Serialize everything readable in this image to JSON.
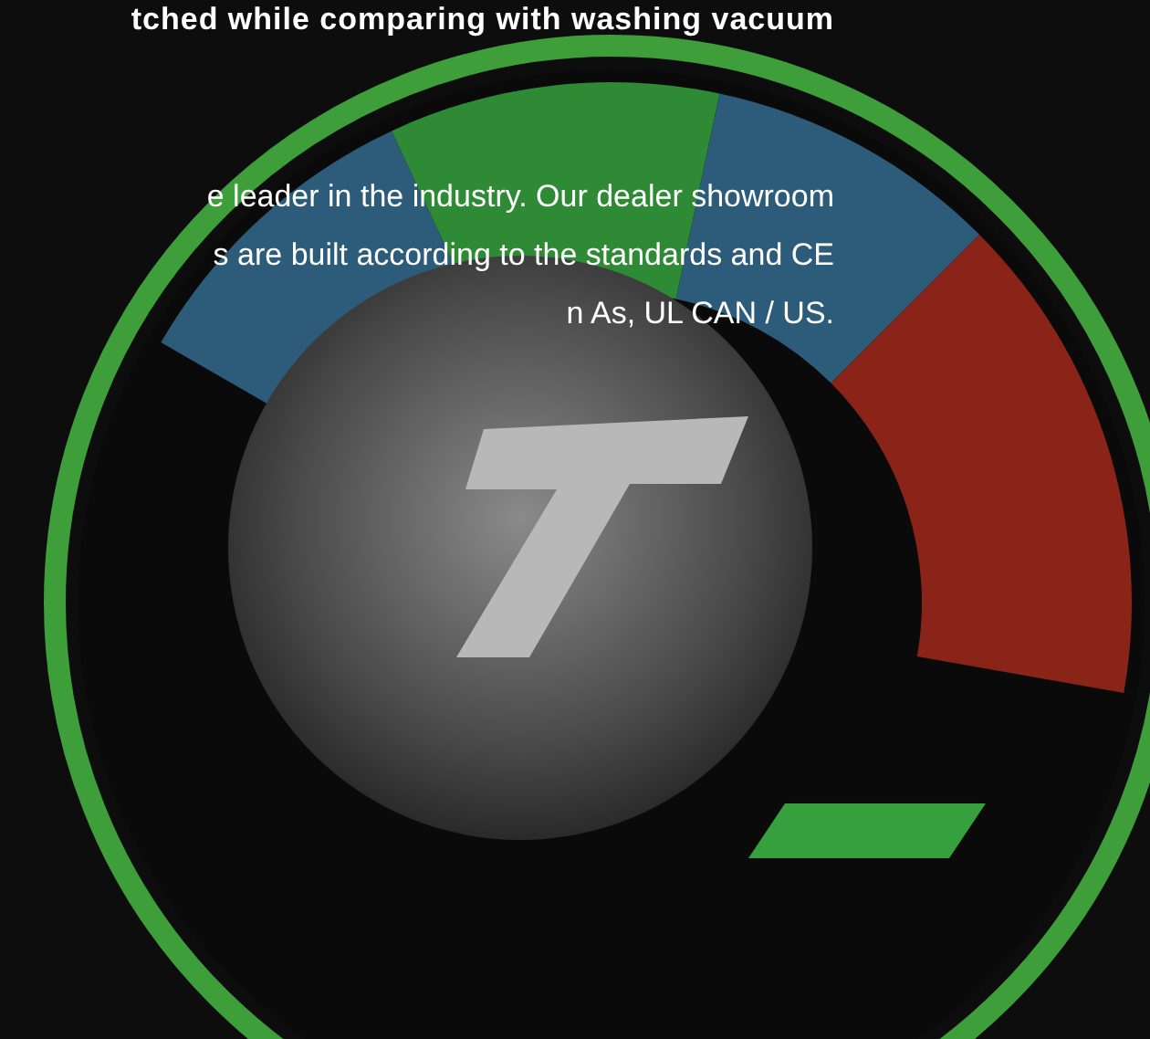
{
  "heading": "tched while comparing with washing vacuum",
  "paragraph_lines": [
    "e leader in the industry. Our dealer showroom",
    "s are built according to the standards and CE",
    "n As, UL CAN / US."
  ]
}
